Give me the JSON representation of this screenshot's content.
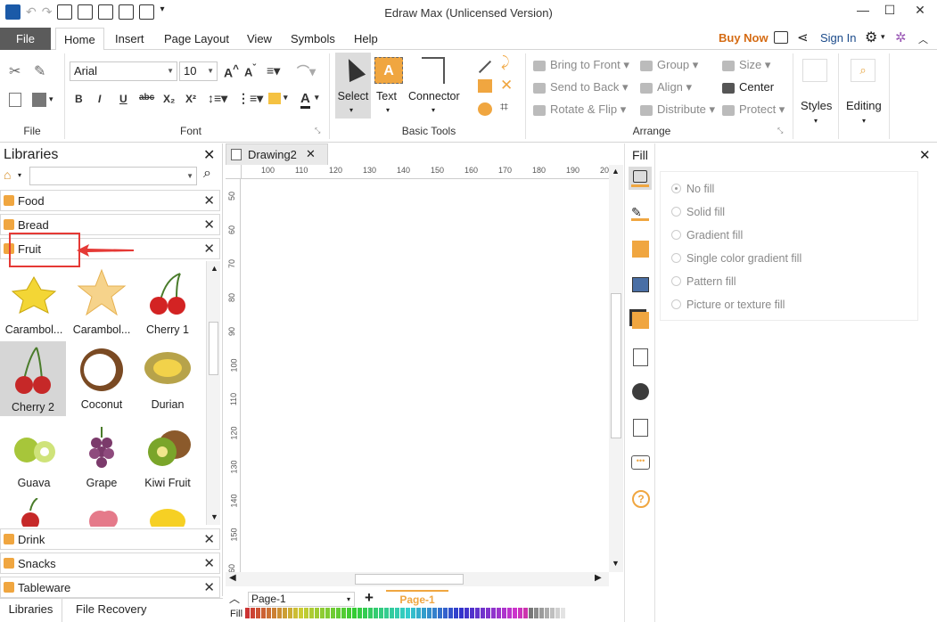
{
  "app": {
    "title": "Edraw Max (Unlicensed Version)",
    "buy_now": "Buy Now",
    "sign_in": "Sign In"
  },
  "menu": {
    "file": "File",
    "tabs": [
      "Home",
      "Insert",
      "Page Layout",
      "View",
      "Symbols",
      "Help"
    ]
  },
  "ribbon": {
    "groups": {
      "file": "File",
      "font": "Font",
      "basic_tools": "Basic Tools",
      "arrange": "Arrange"
    },
    "font_family": "Arial",
    "font_size": "10",
    "tools": {
      "select": "Select",
      "text": "Text",
      "connector": "Connector"
    },
    "arrange": {
      "bring_to_front": "Bring to Front",
      "send_to_back": "Send to Back",
      "rotate_flip": "Rotate & Flip",
      "group": "Group",
      "align": "Align",
      "distribute": "Distribute",
      "size": "Size",
      "center": "Center",
      "protect": "Protect"
    },
    "styles": "Styles",
    "editing": "Editing"
  },
  "libraries": {
    "title": "Libraries",
    "search_placeholder": "",
    "categories_top": [
      "Food",
      "Bread",
      "Fruit"
    ],
    "categories_bottom": [
      "Drink",
      "Snacks",
      "Tableware"
    ],
    "shapes": [
      {
        "label": "Carambol...",
        "icon": "carambola-slice-icon"
      },
      {
        "label": "Carambol...",
        "icon": "carambola-star-icon"
      },
      {
        "label": "Cherry 1",
        "icon": "cherry-icon"
      },
      {
        "label": "Cherry 2",
        "icon": "cherry-icon",
        "selected": true
      },
      {
        "label": "Coconut",
        "icon": "coconut-icon"
      },
      {
        "label": "Durian",
        "icon": "durian-icon"
      },
      {
        "label": "Guava",
        "icon": "guava-icon"
      },
      {
        "label": "Grape",
        "icon": "grape-icon"
      },
      {
        "label": "Kiwi Fruit",
        "icon": "kiwi-icon"
      }
    ]
  },
  "document": {
    "tab": "Drawing2",
    "hruler": [
      "100",
      "110",
      "120",
      "130",
      "140",
      "150",
      "160",
      "170",
      "180",
      "190",
      "20"
    ],
    "vruler": [
      "50",
      "60",
      "70",
      "80",
      "90",
      "100",
      "110",
      "120",
      "130",
      "140",
      "150",
      "60"
    ]
  },
  "fill_panel": {
    "title": "Fill",
    "options": [
      "No fill",
      "Solid fill",
      "Gradient fill",
      "Single color gradient fill",
      "Pattern fill",
      "Picture or texture fill"
    ],
    "selected": "No fill"
  },
  "bottom": {
    "tabs": [
      "Libraries",
      "File Recovery"
    ],
    "page_selector": "Page-1",
    "page_tab": "Page-1",
    "fill_label": "Fill"
  },
  "colors": {
    "accent_orange": "#f0a640",
    "file_tab": "#5b5b5b",
    "buy_now": "#d56b13",
    "annotation_red": "#e53935"
  }
}
